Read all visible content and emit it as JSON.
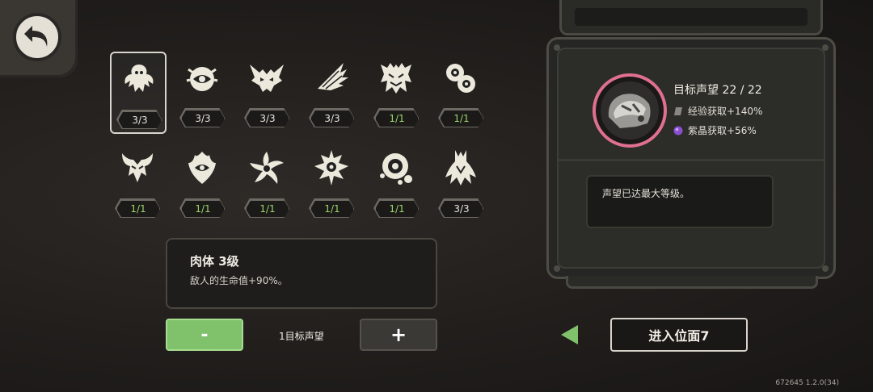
{
  "back_button": {
    "icon": "undo-arrow-icon"
  },
  "modifiers": [
    {
      "icon": "wing-creature-icon",
      "level": "3/3",
      "selected": true,
      "green": false
    },
    {
      "icon": "eye-sphere-icon",
      "level": "3/3",
      "selected": false,
      "green": false
    },
    {
      "icon": "demon-skull-icon",
      "level": "3/3",
      "selected": false,
      "green": false
    },
    {
      "icon": "feather-claw-icon",
      "level": "3/3",
      "selected": false,
      "green": false
    },
    {
      "icon": "twin-skull-icon",
      "level": "1/1",
      "selected": false,
      "green": true
    },
    {
      "icon": "swirl-orbs-icon",
      "level": "1/1",
      "selected": false,
      "green": true
    },
    {
      "icon": "horned-mask-icon",
      "level": "1/1",
      "selected": false,
      "green": true
    },
    {
      "icon": "flame-eye-icon",
      "level": "1/1",
      "selected": false,
      "green": true
    },
    {
      "icon": "spiral-star-icon",
      "level": "1/1",
      "selected": false,
      "green": true
    },
    {
      "icon": "spiked-orb-icon",
      "level": "1/1",
      "selected": false,
      "green": true
    },
    {
      "icon": "target-orb-icon",
      "level": "1/1",
      "selected": false,
      "green": true
    },
    {
      "icon": "root-claw-icon",
      "level": "3/3",
      "selected": false,
      "green": false
    }
  ],
  "selected_info": {
    "title": "肉体 3级",
    "description": "敌人的生命值+90%。"
  },
  "controls": {
    "minus_label": "-",
    "level_label": "1目标声望",
    "plus_label": "+"
  },
  "reputation": {
    "title": "目标声望 22 / 22",
    "exp_bonus": "经验获取+140%",
    "crystal_bonus": "紫晶获取+56%",
    "message": "声望已达最大等级。"
  },
  "enter_button": {
    "label": "进入位面7"
  },
  "version": "672645 1.2.0(34)",
  "colors": {
    "accent_green": "#7fc26b",
    "badge_green_text": "#9ad36a",
    "ring_pink": "#e07090",
    "crystal_purple": "#8a4fd0"
  }
}
